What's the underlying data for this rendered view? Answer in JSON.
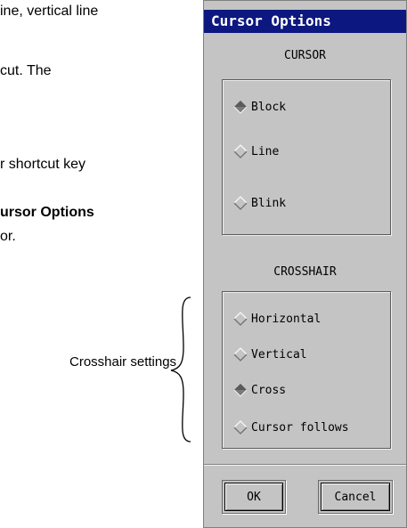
{
  "document": {
    "line1": "ine, vertical line",
    "line2": "cut. The",
    "line3": "r shortcut key",
    "line4": "ursor Options",
    "line5": "or.",
    "callout": "Crosshair settings"
  },
  "dialog": {
    "title": "Cursor Options",
    "cursor_section": {
      "title": "CURSOR",
      "options": [
        {
          "label": "Block",
          "selected": true
        },
        {
          "label": "Line",
          "selected": false
        },
        {
          "label": "Blink",
          "selected": false
        }
      ]
    },
    "crosshair_section": {
      "title": "CROSSHAIR",
      "options": [
        {
          "label": "Horizontal",
          "selected": false
        },
        {
          "label": "Vertical",
          "selected": false
        },
        {
          "label": "Cross",
          "selected": true
        },
        {
          "label": "Cursor follows",
          "selected": false
        }
      ]
    },
    "buttons": {
      "ok": "OK",
      "cancel": "Cancel"
    }
  },
  "colors": {
    "title_bg": "#0c1780",
    "dialog_bg": "#c4c4c4"
  }
}
